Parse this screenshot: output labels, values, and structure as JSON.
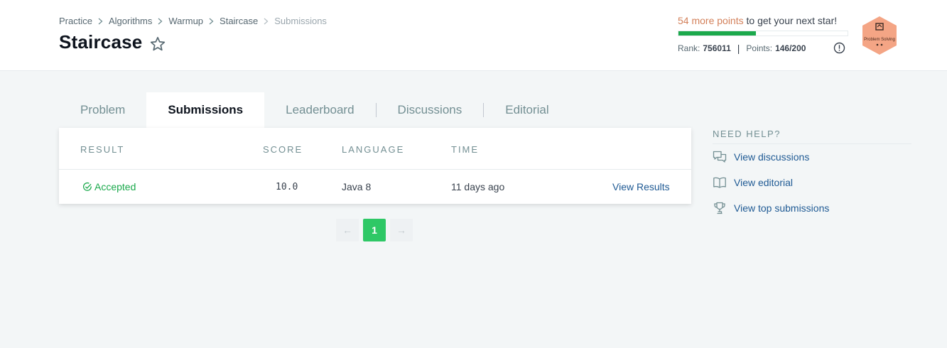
{
  "breadcrumb": [
    "Practice",
    "Algorithms",
    "Warmup",
    "Staircase",
    "Submissions"
  ],
  "title": "Staircase",
  "progress": {
    "points_highlight": "54 more points",
    "points_rest": " to get your next star!",
    "fill_fraction": 0.46,
    "rank_label": "Rank:",
    "rank_value": "756011",
    "points_label": "Points:",
    "points_value": "146/200",
    "separator": "|"
  },
  "badge": {
    "label": "Problem Solving",
    "color": "#f4a585"
  },
  "tabs": [
    {
      "label": "Problem",
      "active": false
    },
    {
      "label": "Submissions",
      "active": true
    },
    {
      "label": "Leaderboard",
      "active": false
    },
    {
      "label": "Discussions",
      "active": false
    },
    {
      "label": "Editorial",
      "active": false
    }
  ],
  "table": {
    "headers": [
      "RESULT",
      "SCORE",
      "LANGUAGE",
      "TIME"
    ],
    "rows": [
      {
        "result": "Accepted",
        "score": "10.0",
        "language": "Java 8",
        "time": "11 days ago",
        "action": "View Results"
      }
    ]
  },
  "pagination": {
    "prev_icon": "←",
    "current": "1",
    "next_icon": "→"
  },
  "help": {
    "title": "NEED HELP?",
    "items": [
      {
        "label": "View discussions",
        "icon": "discussion-icon"
      },
      {
        "label": "View editorial",
        "icon": "book-icon"
      },
      {
        "label": "View top submissions",
        "icon": "trophy-icon"
      }
    ]
  },
  "colors": {
    "accent_green": "#1ba94c",
    "pager_active": "#2ec866",
    "link": "#1f5a94",
    "points_highlight": "#d3805a"
  }
}
